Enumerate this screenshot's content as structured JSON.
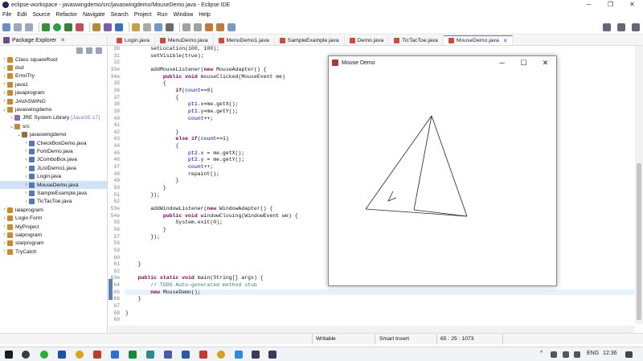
{
  "window": {
    "title": "eclipse-workspace - javaswingdemo/src/javaswingdemo/MouseDemo.java - Eclipse IDE"
  },
  "menu": [
    "File",
    "Edit",
    "Source",
    "Refactor",
    "Navigate",
    "Search",
    "Project",
    "Run",
    "Window",
    "Help"
  ],
  "package_explorer": {
    "tab_label": "Package Explorer",
    "tree": [
      {
        "label": "Class squareRoot",
        "arrow": "›",
        "type": "proj",
        "indent": 0
      },
      {
        "label": "dsd",
        "arrow": "›",
        "type": "proj",
        "indent": 0
      },
      {
        "label": "ErrorTry",
        "arrow": "›",
        "type": "proj",
        "indent": 0
      },
      {
        "label": "java1",
        "arrow": "›",
        "type": "proj",
        "indent": 0
      },
      {
        "label": "javaprogram",
        "arrow": "›",
        "type": "proj",
        "indent": 0
      },
      {
        "label": "JAVASWING",
        "arrow": "›",
        "type": "proj",
        "indent": 0
      },
      {
        "label": "javaswingdemo",
        "arrow": "⌄",
        "type": "proj",
        "indent": 0
      },
      {
        "label": "JRE System Library",
        "tag": "[JavaSE-17]",
        "arrow": "›",
        "type": "lib",
        "indent": 1
      },
      {
        "label": "src",
        "arrow": "⌄",
        "type": "src",
        "indent": 1
      },
      {
        "label": "javaswingdemo",
        "arrow": "⌄",
        "type": "pkg",
        "indent": 2
      },
      {
        "label": "CheckBoxDemo.java",
        "arrow": "›",
        "type": "java",
        "indent": 3
      },
      {
        "label": "FontDemo.java",
        "arrow": "›",
        "type": "java",
        "indent": 3
      },
      {
        "label": "JComboBox.java",
        "arrow": "›",
        "type": "java",
        "indent": 3
      },
      {
        "label": "JListDemo1.java",
        "arrow": "›",
        "type": "java",
        "indent": 3
      },
      {
        "label": "Login.java",
        "arrow": "›",
        "type": "java",
        "indent": 3
      },
      {
        "label": "MouseDemo.java",
        "arrow": "›",
        "type": "java",
        "indent": 3,
        "selected": true
      },
      {
        "label": "SampleExample.java",
        "arrow": "›",
        "type": "java",
        "indent": 3
      },
      {
        "label": "TicTacToe.java",
        "arrow": "›",
        "type": "java",
        "indent": 3
      },
      {
        "label": "lalaprogram",
        "arrow": "›",
        "type": "proj",
        "indent": 0
      },
      {
        "label": "Login Form",
        "arrow": "›",
        "type": "proj",
        "indent": 0
      },
      {
        "label": "MyProject",
        "arrow": "›",
        "type": "proj",
        "indent": 0
      },
      {
        "label": "saiprogram",
        "arrow": "›",
        "type": "proj",
        "indent": 0
      },
      {
        "label": "starprogram",
        "arrow": "›",
        "type": "proj",
        "indent": 0
      },
      {
        "label": "TryCatch",
        "arrow": "›",
        "type": "proj",
        "indent": 0
      }
    ]
  },
  "editor_tabs": [
    {
      "label": "Login.java"
    },
    {
      "label": "MenuDemo.java"
    },
    {
      "label": "MenuDemo1.java"
    },
    {
      "label": "SampleExample.java"
    },
    {
      "label": "Demo.java"
    },
    {
      "label": "TicTacToe.java"
    },
    {
      "label": "MouseDemo.java",
      "active": true,
      "close": "✕"
    }
  ],
  "code_lines": [
    {
      "n": "30",
      "t": "        setLocation(100, 100);"
    },
    {
      "n": "31",
      "t": "        setVisible(true);"
    },
    {
      "n": "32",
      "t": ""
    },
    {
      "n": "33⊖",
      "t": "        addMouseListener(new MouseAdapter() {"
    },
    {
      "n": "34⊖",
      "t": "            public void mouseClicked(MouseEvent me)"
    },
    {
      "n": "35",
      "t": "            {"
    },
    {
      "n": "36",
      "t": "                if(count==0)"
    },
    {
      "n": "37",
      "t": "                {"
    },
    {
      "n": "38",
      "t": "                    pt1.x=me.getX();"
    },
    {
      "n": "39",
      "t": "                    pt1.y=me.getY();"
    },
    {
      "n": "40",
      "t": "                    count++;"
    },
    {
      "n": "41",
      "t": ""
    },
    {
      "n": "42",
      "t": "                }"
    },
    {
      "n": "43",
      "t": "                else if(count==1)"
    },
    {
      "n": "44",
      "t": "                {"
    },
    {
      "n": "45",
      "t": "                    pt2.x = me.getX();"
    },
    {
      "n": "46",
      "t": "                    pt2.y = me.getY();"
    },
    {
      "n": "47",
      "t": "                    count++;"
    },
    {
      "n": "48",
      "t": "                    repaint();"
    },
    {
      "n": "49",
      "t": "                }"
    },
    {
      "n": "50",
      "t": "            }"
    },
    {
      "n": "51",
      "t": "        });"
    },
    {
      "n": "52",
      "t": ""
    },
    {
      "n": "53⊖",
      "t": "        addWindowListener(new WindowAdapter() {"
    },
    {
      "n": "54⊖",
      "t": "            public void windowClosing(WindowEvent we) {"
    },
    {
      "n": "55",
      "t": "                System.exit(0);"
    },
    {
      "n": "56",
      "t": "            }"
    },
    {
      "n": "57",
      "t": "        });"
    },
    {
      "n": "58",
      "t": ""
    },
    {
      "n": "59",
      "t": ""
    },
    {
      "n": "60",
      "t": ""
    },
    {
      "n": "61",
      "t": "    }"
    },
    {
      "n": "62",
      "t": ""
    },
    {
      "n": "63⊖",
      "t": "    public static void main(String[] args) {"
    },
    {
      "n": "64",
      "t": "        // TODO Auto-generated method stub"
    },
    {
      "n": "65",
      "t": "        new MouseDemo();",
      "hl": true
    },
    {
      "n": "66",
      "t": "    }"
    },
    {
      "n": "67",
      "t": ""
    },
    {
      "n": "68",
      "t": "}"
    },
    {
      "n": "69",
      "t": ""
    }
  ],
  "mouse_demo": {
    "title": "Mouse Demo",
    "min": "─",
    "max": "☐",
    "close": "✕"
  },
  "status": {
    "writable": "Writable",
    "insert": "Smart Insert",
    "position": "65 : 25 : 1073"
  },
  "tray": {
    "lang": "ENG",
    "time": "12:36"
  }
}
